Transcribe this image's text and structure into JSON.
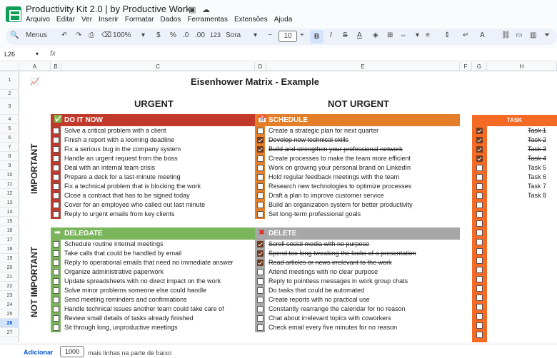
{
  "window": {
    "title": "Productivity Kit 2.0 | by Productive Work"
  },
  "menu": [
    "Arquivo",
    "Editar",
    "Ver",
    "Inserir",
    "Formatar",
    "Dados",
    "Ferramentas",
    "Extensões",
    "Ajuda"
  ],
  "toolbar": {
    "menus": "Menus",
    "zoom": "100%",
    "currency": "$",
    "percent": "%",
    "dec_minus": ".0",
    "dec_plus": ".00",
    "format_num": "123",
    "font": "Sora",
    "font_size": "10"
  },
  "formula_bar": {
    "name_box": "L26",
    "fx": "fx"
  },
  "columns": [
    "A",
    "B",
    "C",
    "D",
    "E",
    "F",
    "G",
    "H"
  ],
  "rows": [
    "1",
    "2",
    "3",
    "4",
    "5",
    "6",
    "7",
    "8",
    "9",
    "10",
    "11",
    "12",
    "13",
    "14",
    "15",
    "16",
    "17",
    "18",
    "19",
    "20",
    "21",
    "22",
    "23",
    "24",
    "25",
    "26",
    "27"
  ],
  "sheet": {
    "title": "Eisenhower Matrix - Example",
    "urgent": "URGENT",
    "not_urgent": "NOT URGENT",
    "important": "IMPORTANT",
    "not_important": "NOT IMPORTANT",
    "quadrants": [
      {
        "title": "DO IT NOW",
        "color": "#c0392b",
        "items": [
          {
            "text": "Solve a critical problem with a client",
            "done": false
          },
          {
            "text": "Finish a report with a looming deadline",
            "done": false
          },
          {
            "text": "Fix a serious bug in the company system",
            "done": false
          },
          {
            "text": "Handle an urgent request from the boss",
            "done": false
          },
          {
            "text": "Deal with an internal team crisis",
            "done": false
          },
          {
            "text": "Prepare a deck for a last-minute meeting",
            "done": false
          },
          {
            "text": "Fix a technical problem that is blocking the work",
            "done": false
          },
          {
            "text": "Close a contract that has to be signed today",
            "done": false
          },
          {
            "text": "Cover for an employee who called out last minute",
            "done": false
          },
          {
            "text": "Reply to urgent emails from key clients",
            "done": false
          }
        ]
      },
      {
        "title": "SCHEDULE",
        "color": "#e57e28",
        "items": [
          {
            "text": "Create a strategic plan for next quarter",
            "done": false
          },
          {
            "text": "Develop new technical skills",
            "done": true
          },
          {
            "text": "Build and strengthen your professional network",
            "done": true
          },
          {
            "text": "Create processes to make the team more efficient",
            "done": false
          },
          {
            "text": "Work on growing your personal brand on LinkedIn",
            "done": false
          },
          {
            "text": "Hold regular feedback meetings with the team",
            "done": false
          },
          {
            "text": "Research new technologies to optimize processes",
            "done": false
          },
          {
            "text": "Draft a plan to improve customer service",
            "done": false
          },
          {
            "text": "Build an organization system for better productivity",
            "done": false
          },
          {
            "text": "Set long-term professional goals",
            "done": false
          }
        ]
      },
      {
        "title": "DELEGATE",
        "color": "#7ab55c",
        "items": [
          {
            "text": "Schedule routine internal meetings",
            "done": false
          },
          {
            "text": "Take calls that could be handled by email",
            "done": false
          },
          {
            "text": "Reply to operational emails that need no immediate answer",
            "done": false
          },
          {
            "text": "Organize administrative paperwork",
            "done": false
          },
          {
            "text": "Update spreadsheets with no direct impact on the work",
            "done": false
          },
          {
            "text": "Solve minor problems someone else could handle",
            "done": false
          },
          {
            "text": "Send meeting reminders and confirmations",
            "done": false
          },
          {
            "text": "Handle technical issues another team could take care of",
            "done": false
          },
          {
            "text": "Review small details of tasks already finished",
            "done": false
          },
          {
            "text": "Sit through long, unproductive meetings",
            "done": false
          }
        ]
      },
      {
        "title": "DELETE",
        "color": "#a7a7a7",
        "items": [
          {
            "text": "Scroll social media with no purpose",
            "done": true
          },
          {
            "text": "Spend too long tweaking the looks of a presentation",
            "done": true
          },
          {
            "text": "Read articles or news irrelevant to the work",
            "done": true
          },
          {
            "text": "Attend meetings with no clear purpose",
            "done": false
          },
          {
            "text": "Reply to pointless messages in work group chats",
            "done": false
          },
          {
            "text": "Do tasks that could be automated",
            "done": false
          },
          {
            "text": "Create reports with no practical use",
            "done": false
          },
          {
            "text": "Constantly rearrange the calendar for no reason",
            "done": false
          },
          {
            "text": "Chat about irrelevant topics with coworkers",
            "done": false
          },
          {
            "text": "Check email every five minutes for no reason",
            "done": false
          }
        ]
      }
    ],
    "task_header": "TASK",
    "tasks": [
      {
        "text": "Task 1",
        "done": true
      },
      {
        "text": "Task 2",
        "done": true
      },
      {
        "text": "Task 3",
        "done": true
      },
      {
        "text": "Task 4",
        "done": true
      },
      {
        "text": "Task 5",
        "done": false
      },
      {
        "text": "Task 6",
        "done": false
      },
      {
        "text": "Task 7",
        "done": false
      },
      {
        "text": "Task 8",
        "done": false
      }
    ]
  },
  "bottom": {
    "add": "Adicionar",
    "rows": "1000",
    "suffix": "mais linhas na parte de baixo"
  }
}
